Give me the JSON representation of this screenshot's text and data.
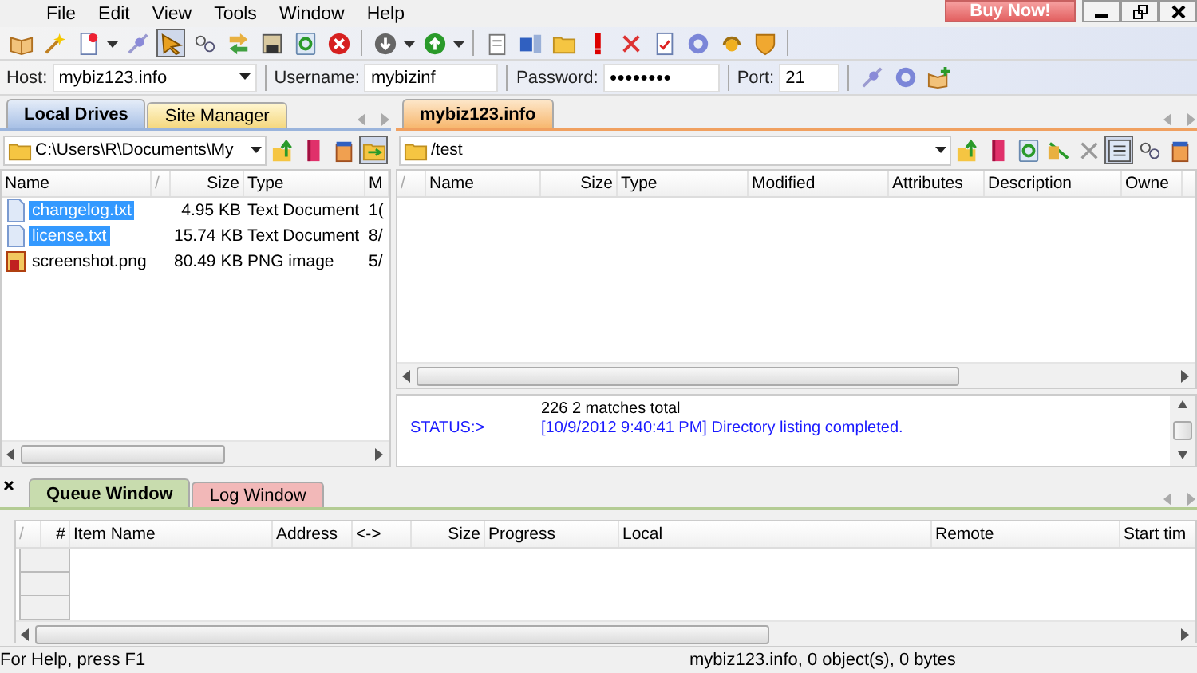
{
  "menu": [
    "File",
    "Edit",
    "View",
    "Tools",
    "Window",
    "Help"
  ],
  "buy_button": "Buy Now!",
  "connection": {
    "host_label": "Host:",
    "host": "mybiz123.info",
    "username_label": "Username:",
    "username": "mybizinf",
    "password_label": "Password:",
    "password": "●●●●●●●●",
    "port_label": "Port:",
    "port": "21"
  },
  "left_tabs": [
    {
      "label": "Local Drives",
      "selected": true
    },
    {
      "label": "Site Manager",
      "selected": false
    }
  ],
  "left_path": "C:\\Users\\R\\Documents\\My",
  "left_columns": [
    "Name",
    "/",
    "Size",
    "Type",
    "M"
  ],
  "left_rows": [
    {
      "name": "changelog.txt",
      "size": "4.95 KB",
      "type": "Text Document",
      "modified": "1(",
      "kind": "text",
      "selected": true
    },
    {
      "name": "license.txt",
      "size": "15.74 KB",
      "type": "Text Document",
      "modified": "8/",
      "kind": "text",
      "selected": true
    },
    {
      "name": "screenshot.png",
      "size": "80.49 KB",
      "type": "PNG image",
      "modified": "5/",
      "kind": "image",
      "selected": false
    }
  ],
  "right_tabs": [
    {
      "label": "mybiz123.info",
      "selected": true
    }
  ],
  "right_path": "/test",
  "right_columns": [
    "/",
    "Name",
    "Size",
    "Type",
    "Modified",
    "Attributes",
    "Description",
    "Owne"
  ],
  "log": [
    {
      "text": "226 2 matches total",
      "kind": "reply"
    },
    {
      "prefix": "STATUS:>",
      "text": "[10/9/2012 9:40:41 PM] Directory listing completed.",
      "kind": "status"
    }
  ],
  "bottom_tabs": [
    {
      "label": "Queue Window",
      "selected": true,
      "color": "#c8dcae"
    },
    {
      "label": "Log Window",
      "selected": false,
      "color": "#f2b8b8"
    }
  ],
  "queue_columns": [
    "/",
    "#",
    "Item Name",
    "Address",
    "<->",
    "Size",
    "Progress",
    "Local",
    "Remote",
    "Start tim"
  ],
  "status_bar": {
    "help": "For Help, press F1",
    "info": "mybiz123.info, 0 object(s), 0 bytes"
  }
}
